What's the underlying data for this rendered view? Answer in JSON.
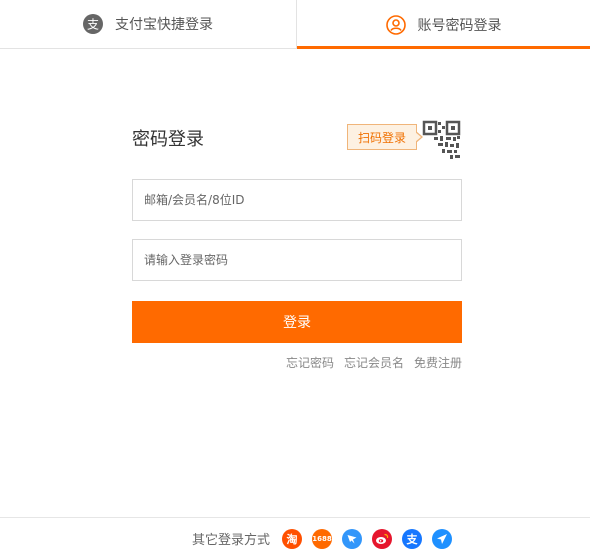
{
  "tabs": [
    {
      "label": "支付宝快捷登录",
      "icon": "alipay-icon",
      "active": false
    },
    {
      "label": "账号密码登录",
      "icon": "user-circle-icon",
      "active": true
    }
  ],
  "login": {
    "title": "密码登录",
    "qr_badge": "扫码登录",
    "qr_icon": "qr-code-icon",
    "username_placeholder": "邮箱/会员名/8位ID",
    "password_placeholder": "请输入登录密码",
    "submit_label": "登录",
    "links": [
      "忘记密码",
      "忘记会员名",
      "免费注册"
    ]
  },
  "footer": {
    "label": "其它登录方式",
    "providers": [
      {
        "name": "taobao-icon",
        "text": "淘",
        "color": "#ff5000"
      },
      {
        "name": "1688-icon",
        "text": "1688",
        "color": "#ff6a00"
      },
      {
        "name": "dingtalk-icon",
        "color": "#3296fa"
      },
      {
        "name": "weibo-icon",
        "color": "#e6162d"
      },
      {
        "name": "alipay-icon",
        "color": "#1677ff"
      },
      {
        "name": "airplane-icon",
        "color": "#1e90ff"
      }
    ]
  },
  "colors": {
    "accent": "#ff6a00",
    "badge_bg": "#fdf1e2",
    "badge_border": "#f0b57a"
  }
}
